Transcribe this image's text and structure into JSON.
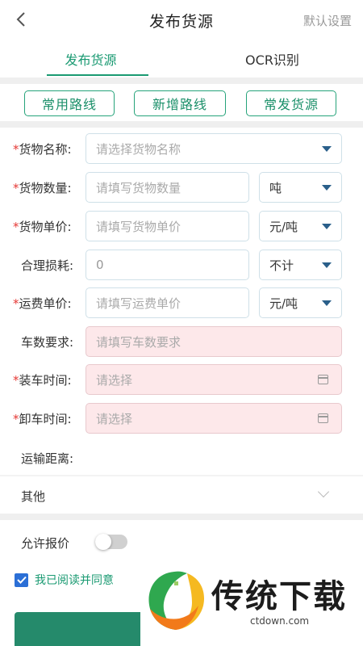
{
  "header": {
    "title": "发布货源",
    "right_link": "默认设置"
  },
  "tabs": [
    {
      "label": "发布货源",
      "active": true
    },
    {
      "label": "OCR识别",
      "active": false
    }
  ],
  "route_buttons": [
    "常用路线",
    "新增路线",
    "常发货源"
  ],
  "form": {
    "goods_name": {
      "label": "货物名称:",
      "required": true,
      "placeholder": "请选择货物名称"
    },
    "goods_quantity": {
      "label": "货物数量:",
      "required": true,
      "placeholder": "请填写货物数量",
      "unit": "吨"
    },
    "unit_price": {
      "label": "货物单价:",
      "required": true,
      "placeholder": "请填写货物单价",
      "unit": "元/吨"
    },
    "loss": {
      "label": "合理损耗:",
      "required": false,
      "value": "0",
      "unit": "不计"
    },
    "freight_price": {
      "label": "运费单价:",
      "required": true,
      "placeholder": "请填写运费单价",
      "unit": "元/吨"
    },
    "vehicle_req": {
      "label": "车数要求:",
      "required": false,
      "placeholder": "请填写车数要求"
    },
    "load_time": {
      "label": "装车时间:",
      "required": true,
      "placeholder": "请选择"
    },
    "unload_time": {
      "label": "卸车时间:",
      "required": true,
      "placeholder": "请选择"
    },
    "distance": {
      "label": "运输距离:",
      "required": false
    }
  },
  "other": {
    "label": "其他"
  },
  "allow_bid": {
    "label": "允许报价",
    "enabled": false
  },
  "agreement": {
    "text": "我已阅读并同意",
    "checked": true
  },
  "watermark": {
    "brand": "传统下载",
    "url": "ctdown.com"
  },
  "colors": {
    "accent": "#1a9a72",
    "required": "#e53935",
    "pink_field": "#fde8ea",
    "checkbox": "#2b6fd6"
  },
  "icons": {
    "back": "chevron-left-icon",
    "dropdown": "caret-down-icon",
    "calendar": "calendar-icon",
    "expand": "chevron-down-icon"
  }
}
